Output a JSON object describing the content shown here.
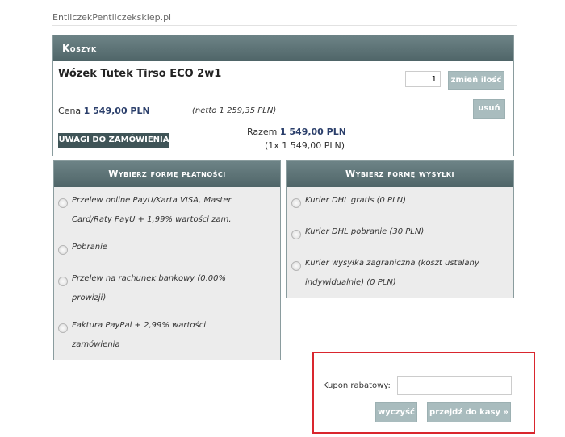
{
  "site": {
    "name": "EntliczekPentliczeksklep.pl"
  },
  "cart": {
    "header": "Koszyk",
    "product_name": "Wózek Tutek Tirso ECO 2w1",
    "quantity": "1",
    "update_label": "zmień ilość",
    "remove_label": "usuń",
    "price_label": "Cena",
    "price_value": "1 549,00 PLN",
    "netto": "(netto 1 259,35 PLN)",
    "notes_label": "UWAGI DO ZAMÓWIENIA",
    "total_label": "Razem",
    "total_value": "1 549,00 PLN",
    "total_breakdown": "(1x 1 549,00 PLN)"
  },
  "payment": {
    "header": "Wybierz formę płatności",
    "options": [
      {
        "line1": "Przelew online PayU/Karta VISA, Master",
        "line2": "Card/Raty PayU + 1,99% wartości zam."
      },
      {
        "line1": "Pobranie",
        "line2": ""
      },
      {
        "line1": "Przelew na rachunek bankowy (0,00%",
        "line2": "prowizji)"
      },
      {
        "line1": "Faktura PayPal + 2,99% wartości",
        "line2": "zamówienia"
      }
    ]
  },
  "shipping": {
    "header": "Wybierz formę wysyłki",
    "options": [
      {
        "line1": "Kurier DHL gratis (0 PLN)",
        "line2": ""
      },
      {
        "line1": "Kurier DHL pobranie (30 PLN)",
        "line2": ""
      },
      {
        "line1": "Kurier wysyłka zagraniczna (koszt ustalany",
        "line2": "indywidualnie) (0 PLN)"
      }
    ]
  },
  "coupon": {
    "label": "Kupon rabatowy:",
    "value": "",
    "clear_label": "wyczyść",
    "checkout_label": "przejdź do kasy »"
  },
  "colors": {
    "header_bg": "#5a7073",
    "button_bg": "#a9bcbe",
    "price": "#2b3f6b",
    "highlight_border": "#d9262e"
  }
}
